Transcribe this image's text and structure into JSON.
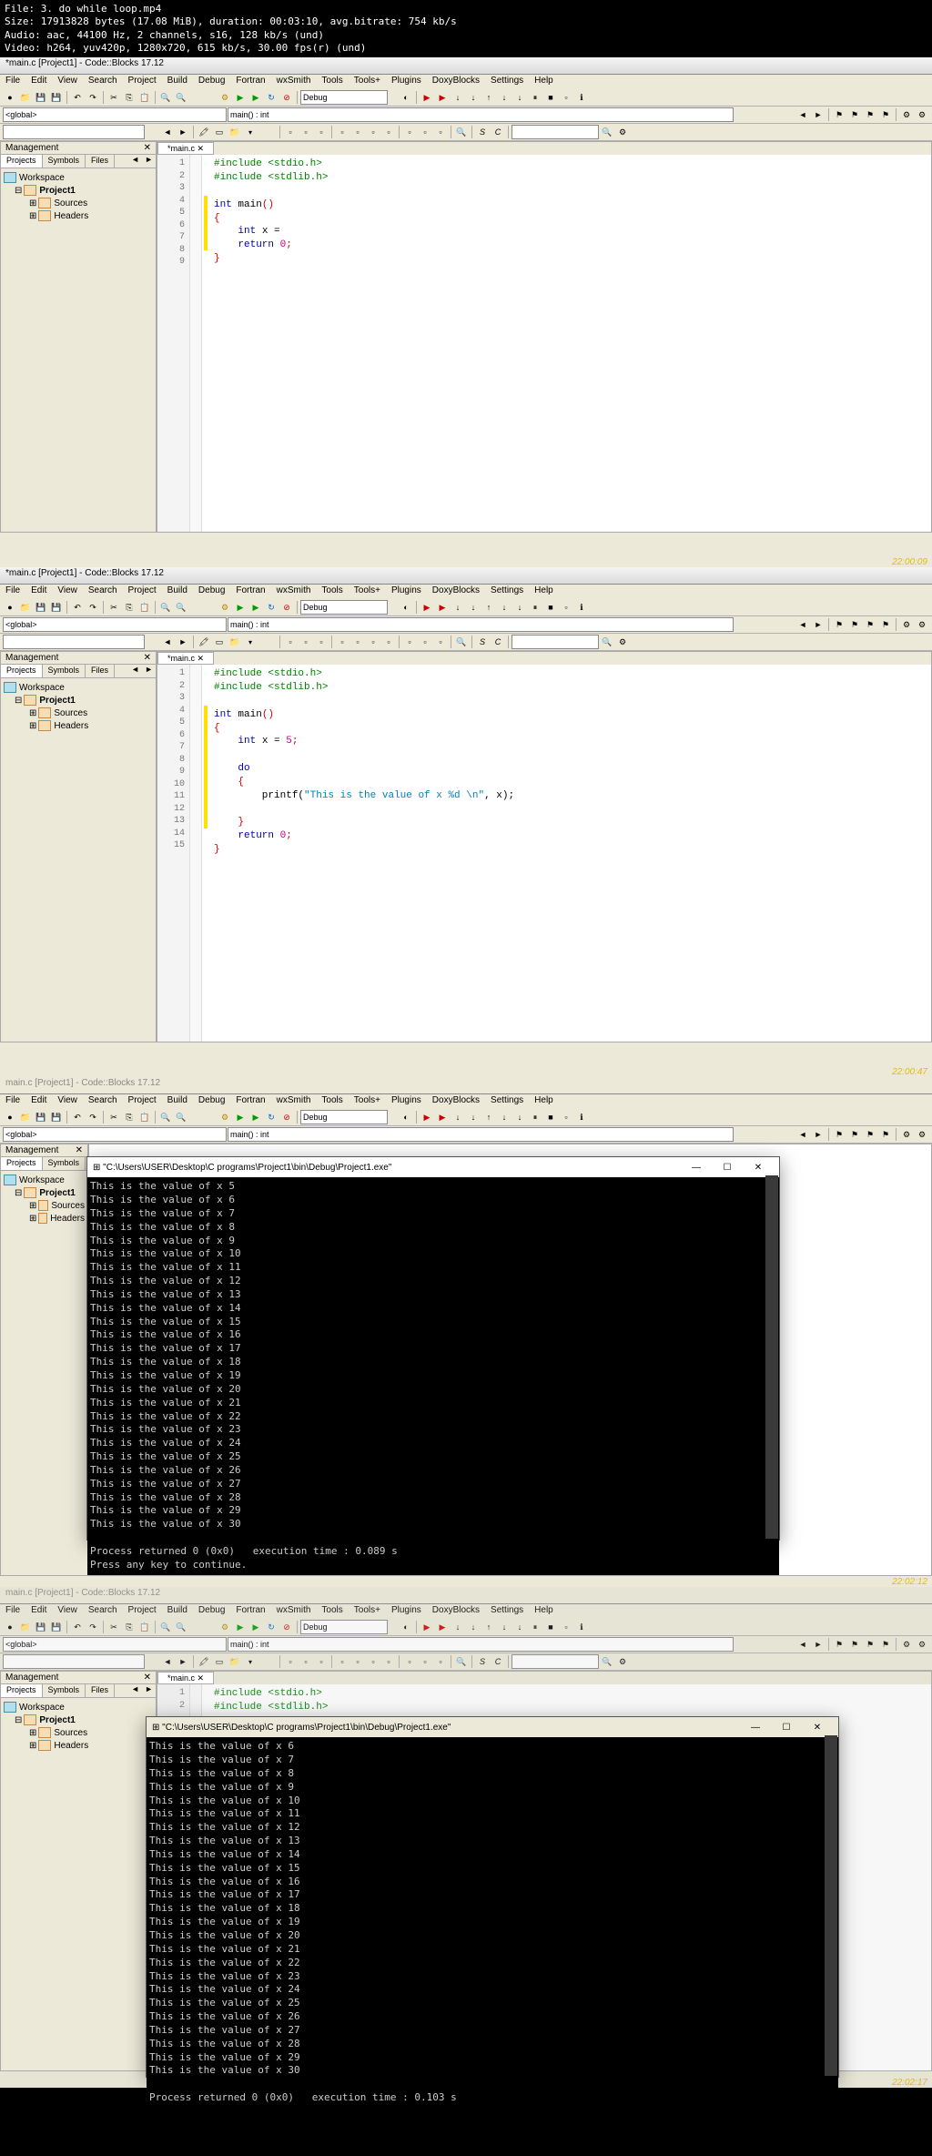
{
  "meta": {
    "file": "File: 3. do while loop.mp4",
    "size": "Size: 17913828 bytes (17.08 MiB), duration: 00:03:10, avg.bitrate: 754 kb/s",
    "audio": "Audio: aac, 44100 Hz, 2 channels, s16, 128 kb/s (und)",
    "video": "Video: h264, yuv420p, 1280x720, 615 kb/s, 30.00 fps(r) (und)"
  },
  "menus": [
    "File",
    "Edit",
    "View",
    "Search",
    "Project",
    "Build",
    "Debug",
    "Fortran",
    "wxSmith",
    "Tools",
    "Tools+",
    "Plugins",
    "DoxyBlocks",
    "Settings",
    "Help"
  ],
  "scope": {
    "left": "<global>",
    "right": "main() : int"
  },
  "buildCombo": "Debug",
  "mpaneTitle": "Management",
  "mpaneTabs": [
    "Projects",
    "Symbols",
    "Files"
  ],
  "tree": {
    "workspace": "Workspace",
    "project": "Project1",
    "sources": "Sources",
    "headers": "Headers"
  },
  "editorTab": "*main.c",
  "f1": {
    "title": "*main.c [Project1] - Code::Blocks 17.12",
    "timestamp": "22:00:09",
    "lines": [
      "1",
      "2",
      "3",
      "4",
      "5",
      "6",
      "7",
      "8",
      "9"
    ],
    "code": {
      "l1a": "#include",
      "l1b": " <stdio.h>",
      "l2a": "#include",
      "l2b": " <stdlib.h>",
      "l3": "",
      "l4a": "int",
      "l4b": " main",
      "l4c": "()",
      "l5": "{",
      "l6a": "    int",
      "l6b": " x = ",
      "l7a": "    return",
      "l7b": " ",
      "l7c": "0",
      "l7d": ";",
      "l8": "}"
    }
  },
  "f2": {
    "title": "*main.c [Project1] - Code::Blocks 17.12",
    "timestamp": "22:00:47",
    "lines": [
      "1",
      "2",
      "3",
      "4",
      "5",
      "6",
      "7",
      "8",
      "9",
      "10",
      "11",
      "12",
      "13",
      "14",
      "15"
    ],
    "code": {
      "l1a": "#include",
      "l1b": " <stdio.h>",
      "l2a": "#include",
      "l2b": " <stdlib.h>",
      "l3": "",
      "l4a": "int",
      "l4b": " main",
      "l4c": "()",
      "l5": "{",
      "l6a": "    int",
      "l6b": " x = ",
      "l6c": "5",
      "l6d": ";",
      "l7": "",
      "l8a": "    do",
      "l9": "    {",
      "l10a": "        printf(",
      "l10b": "\"This is the value of x %d \\n\"",
      "l10c": ", x);",
      "l11": "",
      "l12": "    }",
      "l13a": "    return",
      "l13b": " ",
      "l13c": "0",
      "l13d": ";",
      "l14": "}"
    }
  },
  "f3": {
    "title": "main.c [Project1] - Code::Blocks 17.12",
    "timestamp": "22:02:12",
    "conTitle": "\"C:\\Users\\USER\\Desktop\\C programs\\Project1\\bin\\Debug\\Project1.exe\"",
    "conLines": [
      "This is the value of x 5",
      "This is the value of x 6",
      "This is the value of x 7",
      "This is the value of x 8",
      "This is the value of x 9",
      "This is the value of x 10",
      "This is the value of x 11",
      "This is the value of x 12",
      "This is the value of x 13",
      "This is the value of x 14",
      "This is the value of x 15",
      "This is the value of x 16",
      "This is the value of x 17",
      "This is the value of x 18",
      "This is the value of x 19",
      "This is the value of x 20",
      "This is the value of x 21",
      "This is the value of x 22",
      "This is the value of x 23",
      "This is the value of x 24",
      "This is the value of x 25",
      "This is the value of x 26",
      "This is the value of x 27",
      "This is the value of x 28",
      "This is the value of x 29",
      "This is the value of x 30",
      "",
      "Process returned 0 (0x0)   execution time : 0.089 s",
      "Press any key to continue."
    ]
  },
  "f4": {
    "title": "main.c [Project1] - Code::Blocks 17.12",
    "timestamp": "22:02:17",
    "conTitle": "\"C:\\Users\\USER\\Desktop\\C programs\\Project1\\bin\\Debug\\Project1.exe\"",
    "codeLines": [
      "1",
      "2"
    ],
    "code": {
      "l1a": "#include",
      "l1b": " <stdio.h>",
      "l2a": "#include",
      "l2b": " <stdlib.h>"
    },
    "conLines": [
      "This is the value of x 6",
      "This is the value of x 7",
      "This is the value of x 8",
      "This is the value of x 9",
      "This is the value of x 10",
      "This is the value of x 11",
      "This is the value of x 12",
      "This is the value of x 13",
      "This is the value of x 14",
      "This is the value of x 15",
      "This is the value of x 16",
      "This is the value of x 17",
      "This is the value of x 18",
      "This is the value of x 19",
      "This is the value of x 20",
      "This is the value of x 21",
      "This is the value of x 22",
      "This is the value of x 23",
      "This is the value of x 24",
      "This is the value of x 25",
      "This is the value of x 26",
      "This is the value of x 27",
      "This is the value of x 28",
      "This is the value of x 29",
      "This is the value of x 30",
      "",
      "Process returned 0 (0x0)   execution time : 0.103 s"
    ]
  },
  "icons": {
    "new": "●",
    "open": "📁",
    "save": "💾",
    "saveall": "💾",
    "undo": "↶",
    "redo": "↷",
    "cut": "✂",
    "copy": "⎘",
    "paste": "📋",
    "find": "🔍",
    "replace": "🔍",
    "build": "⚙",
    "run": "▶",
    "buildrun": "▶",
    "rebuild": "↻",
    "stop": "■",
    "toggle": "◐",
    "target": "🎯",
    "debug": "▶",
    "debugrun": "▶",
    "next": "↓",
    "step": "↓",
    "stepout": "↑",
    "nextinst": "↓",
    "stepinto": "↓",
    "break": "⏸",
    "stop2": "■",
    "debugwin": "▫",
    "info": "ℹ",
    "prev": "◄",
    "next2": "►",
    "bookmark": "⚑",
    "highlight": "🖍",
    "sel": "▭",
    "abort": "⊘",
    "S": "S",
    "C": "C",
    "searchicon": "🔍",
    "gear": "⚙",
    "close": "✕",
    "min": "—",
    "max": "☐"
  }
}
